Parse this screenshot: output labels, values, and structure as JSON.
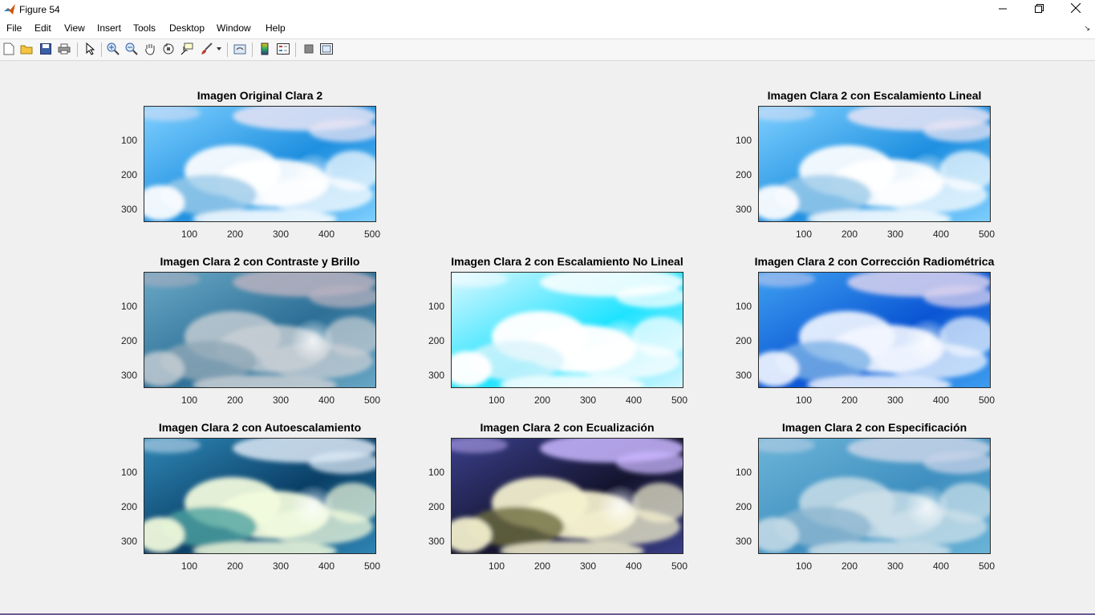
{
  "window": {
    "title": "Figure 54",
    "minimize_icon": "minimize-icon",
    "maximize_icon": "restore-icon",
    "close_icon": "close-icon"
  },
  "menu": {
    "items": [
      "File",
      "Edit",
      "View",
      "Insert",
      "Tools",
      "Desktop",
      "Window",
      "Help"
    ]
  },
  "toolbar": {
    "icons": [
      "new-figure-icon",
      "open-file-icon",
      "save-icon",
      "print-icon",
      "edit-plot-arrow-icon",
      "zoom-in-icon",
      "zoom-out-icon",
      "pan-hand-icon",
      "rotate-3d-icon",
      "data-cursor-icon",
      "brush-icon",
      "link-plot-icon",
      "colorbar-icon",
      "legend-icon",
      "hide-plot-tools-icon",
      "show-plot-tools-icon"
    ]
  },
  "axes_ticks": {
    "y": [
      "100",
      "200",
      "300"
    ],
    "x": [
      "100",
      "200",
      "300",
      "400",
      "500"
    ]
  },
  "plots": [
    {
      "title": "Imagen Original Clara 2",
      "style": "original"
    },
    {
      "title": "Imagen Clara 2 con Escalamiento Lineal",
      "style": "original"
    },
    {
      "title": "Imagen Clara 2 con Contraste y Brillo",
      "style": "muted"
    },
    {
      "title": "Imagen Clara 2 con Escalamiento No Lineal",
      "style": "bright"
    },
    {
      "title": "Imagen Clara 2 con Corrección Radiométrica",
      "style": "deep"
    },
    {
      "title": "Imagen Clara 2 con Autoescalamiento",
      "style": "auto"
    },
    {
      "title": "Imagen Clara 2 con Ecualización",
      "style": "equalized"
    },
    {
      "title": "Imagen Clara 2 con Especificación",
      "style": "spec"
    }
  ]
}
